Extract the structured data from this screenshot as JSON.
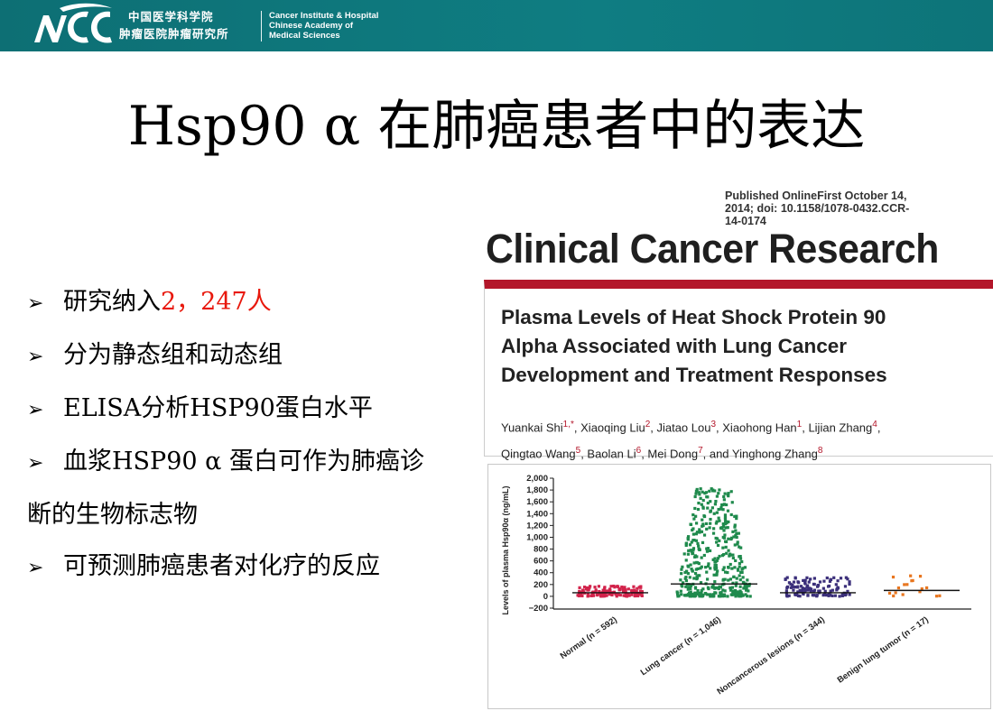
{
  "header": {
    "logo_text": "NCC",
    "institute_cn": [
      "中国医学科学院",
      "肿瘤医院肿瘤研究所"
    ],
    "institute_en": [
      "Cancer Institute & Hospital",
      "Chinese Academy of",
      "Medical Sciences"
    ],
    "bar_color": "#0f7d82"
  },
  "title": "Hsp90 α 在肺癌患者中的表达",
  "bullets": [
    {
      "text": "研究纳入",
      "highlight": "2，247人"
    },
    {
      "text": "分为静态组和动态组"
    },
    {
      "text": "ELISA分析HSP90蛋白水平"
    },
    {
      "text": "血浆HSP90 α 蛋白可作为肺癌诊"
    },
    {
      "text": "断的生物标志物"
    },
    {
      "text": "可预测肺癌患者对化疗的反应"
    }
  ],
  "publication": {
    "published": [
      "Published OnlineFirst October 14,",
      "2014; doi: 10.1158/1078-0432.CCR-",
      "14-0174"
    ],
    "journal": "Clinical Cancer Research",
    "paper_title": [
      "Plasma Levels of Heat Shock Protein 90",
      "Alpha Associated with Lung Cancer",
      "Development and Treatment Responses"
    ],
    "authors_line1": [
      {
        "name": "Yuankai Shi",
        "sup": "1,*"
      },
      {
        "name": ", Xiaoqing Liu",
        "sup": "2"
      },
      {
        "name": ", Jiatao Lou",
        "sup": "3"
      },
      {
        "name": ", Xiaohong Han",
        "sup": "1"
      },
      {
        "name": ", Lijian Zhang",
        "sup": "4"
      },
      {
        "name": ",",
        "sup": ""
      }
    ],
    "authors_line2": [
      {
        "name": "Qingtao Wang",
        "sup": "5"
      },
      {
        "name": ", Baolan Li",
        "sup": "6"
      },
      {
        "name": ", Mei Dong",
        "sup": "7"
      },
      {
        "name": ", and Yinghong Zhang",
        "sup": "8"
      }
    ],
    "accent_color": "#b3162a"
  },
  "chart_data": {
    "type": "scatter",
    "ylabel": "Levels of plasma Hsp90α (ng/mL)",
    "yticks": [
      "2,000",
      "1,800",
      "1,600",
      "1,400",
      "1,200",
      "1,000",
      "800",
      "600",
      "400",
      "200",
      "0",
      "−200"
    ],
    "ylim": [
      -200,
      2000
    ],
    "categories": [
      "Normal (n = 592)",
      "Lung cancer (n = 1,046)",
      "Noncancerous lesions (n = 344)",
      "Benign lung tumor (n = 17)"
    ],
    "colors": [
      "#d2234b",
      "#1f8a4c",
      "#3b2f7a",
      "#e8761f"
    ],
    "medians": [
      60,
      210,
      60,
      100
    ],
    "ranges": [
      [
        0,
        180
      ],
      [
        0,
        1850
      ],
      [
        0,
        320
      ],
      [
        0,
        360
      ]
    ],
    "point_counts": [
      140,
      420,
      120,
      17
    ]
  }
}
